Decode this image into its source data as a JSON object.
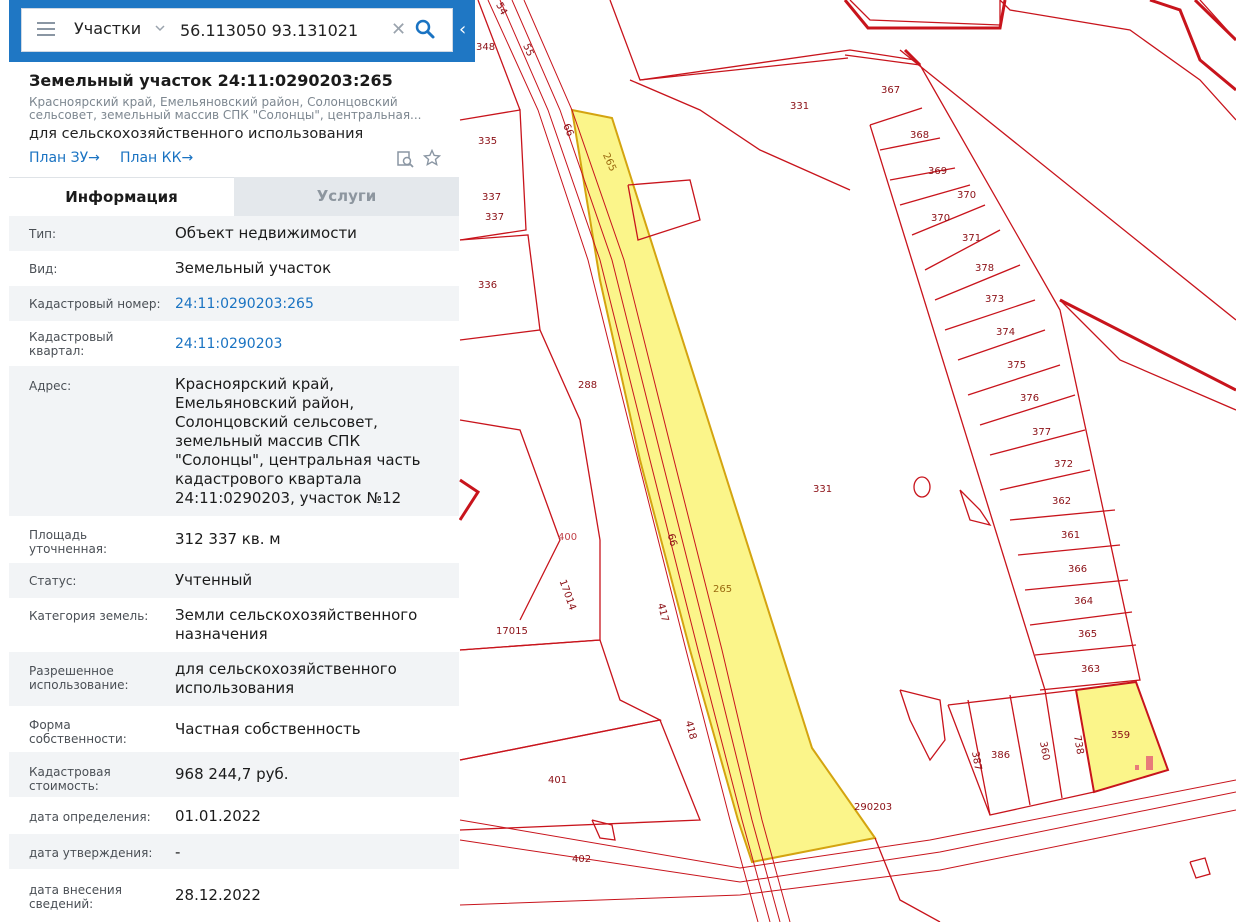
{
  "search": {
    "layer": "Участки",
    "query": "56.113050 93.131021"
  },
  "panel": {
    "title": "Земельный участок 24:11:0290203:265",
    "address_short": "Красноярский край, Емельяновский район, Солонцовский сельсовет, земельный массив СПК \"Солонцы\", центральная...",
    "usage_short": "для сельскохозяйственного использования",
    "plan_zu": "План ЗУ→",
    "plan_kk": "План КК→",
    "tabs": [
      "Информация",
      "Услуги"
    ],
    "rows": [
      {
        "label": "Тип:",
        "value": "Объект недвижимости"
      },
      {
        "label": "Вид:",
        "value": "Земельный участок"
      },
      {
        "label": "Кадастровый номер:",
        "value": "24:11:0290203:265"
      },
      {
        "label": "Кадастровый квартал:",
        "value": "24:11:0290203"
      },
      {
        "label": "Адрес:",
        "value": "Красноярский край, Емельяновский район, Солонцовский сельсовет, земельный массив СПК \"Солонцы\", центральная часть кадастрового квартала 24:11:0290203, участок №12"
      },
      {
        "label": "Площадь уточненная:",
        "value": "312 337 кв. м"
      },
      {
        "label": "Статус:",
        "value": "Учтенный"
      },
      {
        "label": "Категория земель:",
        "value": "Земли сельскохозяйственного назначения"
      },
      {
        "label": "Разрешенное использование:",
        "value": "для сельскохозяйственного использования"
      },
      {
        "label": "Форма собственности:",
        "value": "Частная собственность"
      },
      {
        "label": "Кадастровая стоимость:",
        "value": "968 244,7 руб."
      },
      {
        "label": "дата определения:",
        "value": "01.01.2022"
      },
      {
        "label": "дата утверждения:",
        "value": "-"
      },
      {
        "label": "дата внесения сведений:",
        "value": "28.12.2022"
      }
    ]
  },
  "map": {
    "plot_labels": {
      "p348": "348",
      "p54": "54",
      "p55": "55",
      "p66a": "66",
      "p335": "335",
      "p337a": "337",
      "p337b": "337",
      "p336": "336",
      "p288": "288",
      "p400": "400",
      "p17014": "17014",
      "p17015": "17015",
      "p66b": "66",
      "p417": "417",
      "p418": "418",
      "p401": "401",
      "p402": "402",
      "p331a": "331",
      "p331b": "331",
      "p265a": "265",
      "p265b": "265",
      "p290203": "290203",
      "p367": "367",
      "p368": "368",
      "p369": "369",
      "p370a": "370",
      "p370b": "370",
      "p371": "371",
      "p378": "378",
      "p373": "373",
      "p374": "374",
      "p375": "375",
      "p376": "376",
      "p377": "377",
      "p372": "372",
      "p362": "362",
      "p361": "361",
      "p366": "366",
      "p364": "364",
      "p365": "365",
      "p363": "363",
      "p359": "359",
      "p387": "387",
      "p386": "386",
      "p360": "360",
      "p738": "738"
    },
    "colors": {
      "boundary": "#c8141c",
      "selected_fill": "#fbf58a",
      "selected_stroke": "#d4a410"
    }
  }
}
